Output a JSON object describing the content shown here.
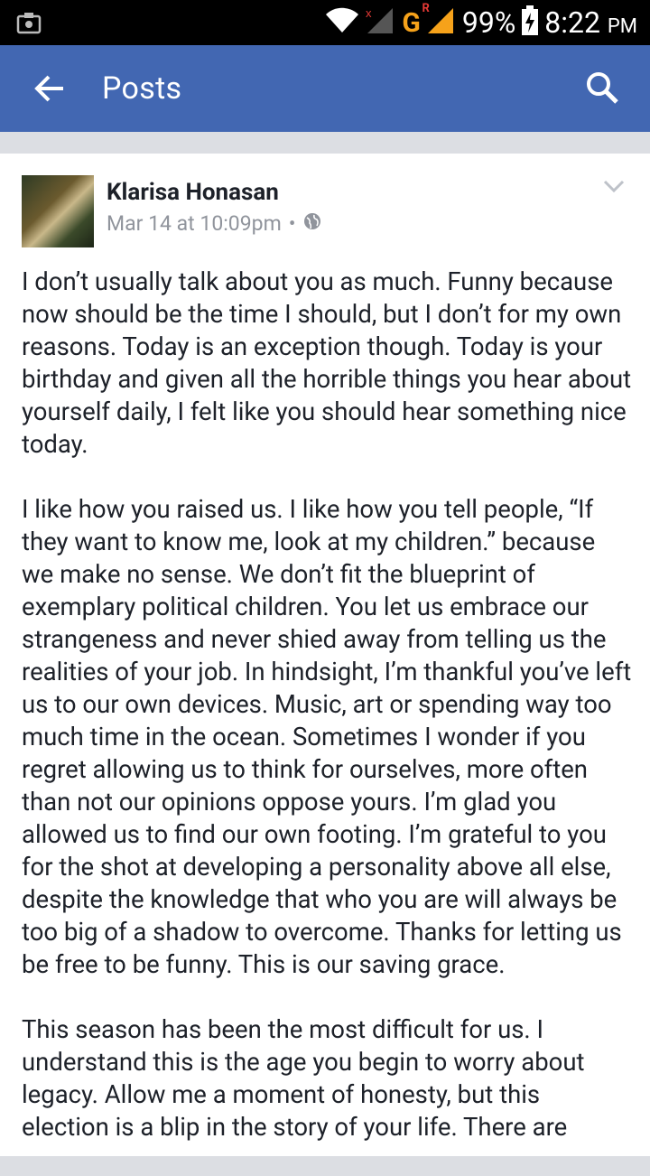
{
  "status_bar": {
    "battery": "99%",
    "time": "8:22",
    "ampm": "PM",
    "network": "G",
    "roaming": "R"
  },
  "app_bar": {
    "title": "Posts"
  },
  "post": {
    "author": "Klarisa Honasan",
    "timestamp": "Mar 14 at 10:09pm",
    "separator": "•",
    "paragraphs": [
      "I don’t usually talk about you as much. Funny because now should be the time I should, but I don’t for my own reasons. Today is an exception though. Today is your birthday and given all the horrible things you hear about yourself daily, I felt like you should hear something nice today.",
      "I like how you raised us. I like how you tell people, “If they want to know me, look at my children.” because we make no sense. We don’t fit the blueprint of exemplary political children. You let us embrace our strangeness and never shied away from telling us the realities of your job. In hindsight, I’m thankful you’ve left us to our own devices. Music, art or spending way too much time in the ocean. Sometimes I wonder if you regret allowing us to think for ourselves, more often than not our opinions oppose yours. I’m glad you allowed us to find our own footing. I’m grateful to you for the shot at developing a personality above all else, despite the knowledge that who you are will always be too big of a shadow to overcome. Thanks for letting us be free to be funny. This is our saving grace.",
      "This season has been the most difficult for us. I understand this is the age you begin to worry about legacy. Allow me a moment of honesty, but this election is a blip in the story of your life. There are"
    ]
  },
  "colors": {
    "app_bar": "#4267b2",
    "text": "#1d2129",
    "meta": "#90949c"
  }
}
